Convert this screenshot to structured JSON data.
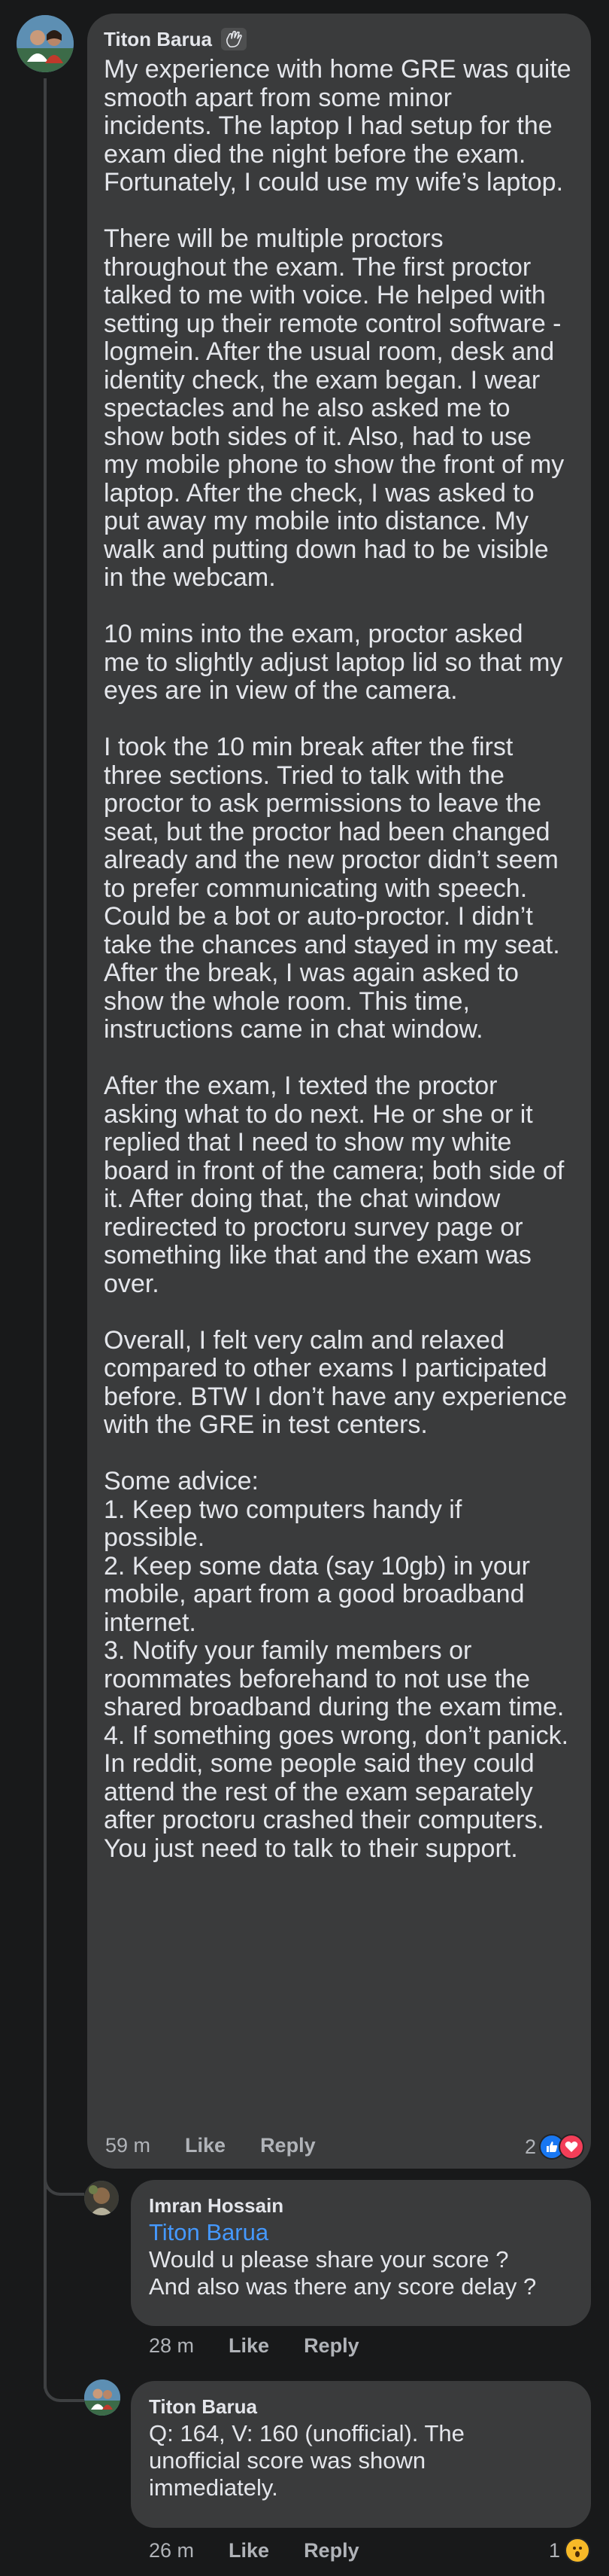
{
  "main_comment": {
    "author": "Titon Barua",
    "paragraphs": [
      [
        "My experience with home GRE was quite",
        "smooth apart from some minor",
        "incidents. The laptop I had setup for the",
        "exam died the night before the exam.",
        "Fortunately, I could use my wife’s laptop."
      ],
      [
        "There will be multiple proctors",
        "throughout the exam. The first proctor",
        "talked to me with voice. He helped with",
        "setting up their remote control software -",
        "logmein. After the usual room, desk and",
        "identity check, the exam began. I wear",
        "spectacles and he also asked me to",
        "show both sides of it. Also, had to use",
        "my mobile phone to show the front of my",
        "laptop. After the check, I was asked to",
        "put away my mobile into distance. My",
        "walk and putting down had to be visible",
        "in the webcam."
      ],
      [
        "10 mins into the exam, proctor  asked",
        "me to slightly adjust laptop lid so that my",
        "eyes are in view of the camera."
      ],
      [
        "I took the 10 min break after the first",
        "three sections. Tried to talk with the",
        "proctor to ask permissions to leave the",
        "seat, but the proctor had been changed",
        "already and the new proctor didn’t seem",
        "to prefer communicating with speech.",
        "Could be a bot or auto-proctor. I didn’t",
        "take the chances and stayed in my seat.",
        "After the break, I was again asked to",
        "show the whole room. This time,",
        "instructions came in chat window."
      ],
      [
        "After the exam, I texted the proctor",
        "asking what to do next. He or she or it",
        "replied that I need to  show my white",
        "board in front of the camera; both side of",
        "it. After doing that, the chat window",
        "redirected to proctoru survey page or",
        "something like that and the exam was",
        "over."
      ],
      [
        "Overall, I felt very calm and relaxed",
        "compared to other exams I participated",
        "before. BTW I don’t have any experience",
        "with the GRE in test centers."
      ],
      [
        "Some advice:",
        "1. Keep two computers handy if",
        "possible.",
        "2. Keep some data (say 10gb) in your",
        "mobile, apart from a good broadband",
        "internet.",
        "3. Notify your family members or",
        "roommates beforehand to not use the",
        "shared broadband during the exam time.",
        "4. If something goes wrong, don’t panick.",
        "In reddit, some people said they could",
        "attend the rest of the exam separately",
        "after proctoru crashed their computers.",
        "You just need to talk to their support."
      ]
    ],
    "time": "59 m",
    "like_label": "Like",
    "reply_label": "Reply",
    "reaction_count": "2",
    "reactions": [
      "like-icon",
      "love-icon"
    ]
  },
  "replies": [
    {
      "author": "Imran Hossain",
      "mention": "Titon Barua",
      "lines": [
        "Would u please share your score ?",
        "And also was there any score delay ?"
      ],
      "time": "28 m",
      "like_label": "Like",
      "reply_label": "Reply"
    },
    {
      "author": "Titon Barua",
      "lines": [
        "Q: 164, V: 160 (unofficial). The",
        "unofficial score was shown",
        "immediately."
      ],
      "time": "26 m",
      "like_label": "Like",
      "reply_label": "Reply",
      "reaction_count": "1",
      "reactions": [
        "wow-icon"
      ]
    }
  ],
  "colors": {
    "background": "#18191a",
    "bubble": "#3a3b3c",
    "text": "#e4e6eb",
    "secondary": "#b0b3b8",
    "link": "#4599ff",
    "like_blue": "#1877f2",
    "love_red": "#f33e58",
    "wow_yellow": "#f7b928"
  }
}
